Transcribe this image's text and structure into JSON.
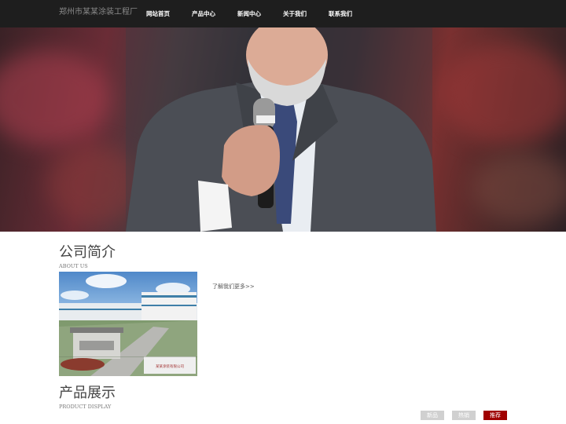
{
  "header": {
    "site_name": "郑州市某某涂装工程厂",
    "nav": [
      "网站首页",
      "产品中心",
      "新闻中心",
      "关于我们",
      "联系我们"
    ]
  },
  "banner": {
    "slide_count": 9,
    "active_slide": 0
  },
  "about": {
    "title": "公司简介",
    "subtitle": "ABOUT US",
    "more_link": "了解我们更多>>",
    "image_sign_text": "某某涂装有限公司"
  },
  "products": {
    "title": "产品展示",
    "subtitle": "PRODUCT DISPLAY",
    "tabs": [
      {
        "label": "新品",
        "active": false
      },
      {
        "label": "热销",
        "active": false
      },
      {
        "label": "推荐",
        "active": true
      }
    ]
  },
  "colors": {
    "topbar": "#1e1e1e",
    "tab_inactive": "#d0d0d0",
    "tab_active": "#a00000"
  }
}
